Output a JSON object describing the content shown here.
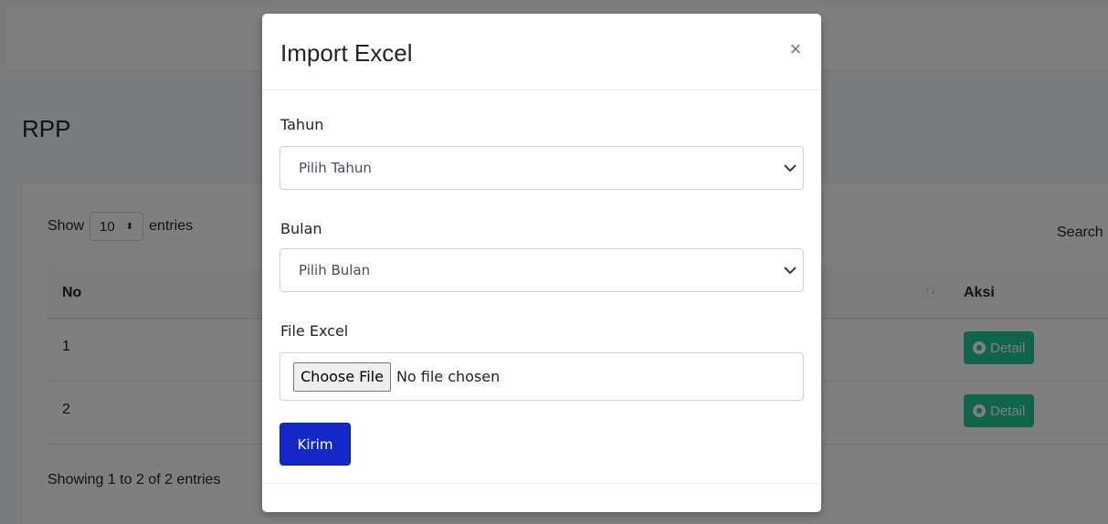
{
  "page": {
    "title": "RPP",
    "length_prefix": "Show",
    "length_value": "10",
    "length_suffix": "entries",
    "search_label": "Search",
    "table_headers": {
      "no": "No",
      "aksi": "Aksi"
    },
    "rows": [
      {
        "no": "1",
        "action": "Detail"
      },
      {
        "no": "2",
        "action": "Detail"
      }
    ],
    "info": "Showing 1 to 2 of 2 entries"
  },
  "modal": {
    "title": "Import Excel",
    "close_symbol": "×",
    "tahun_label": "Tahun",
    "tahun_selected": "Pilih Tahun",
    "bulan_label": "Bulan",
    "bulan_selected": "Pilih Bulan",
    "file_label": "File Excel",
    "choose_file": "Choose File",
    "no_file": "No file chosen",
    "submit": "Kirim"
  },
  "colors": {
    "detail_button": "#20c997",
    "submit_button": "#1428c8",
    "overlay": "rgba(0,0,0,0.5)"
  }
}
